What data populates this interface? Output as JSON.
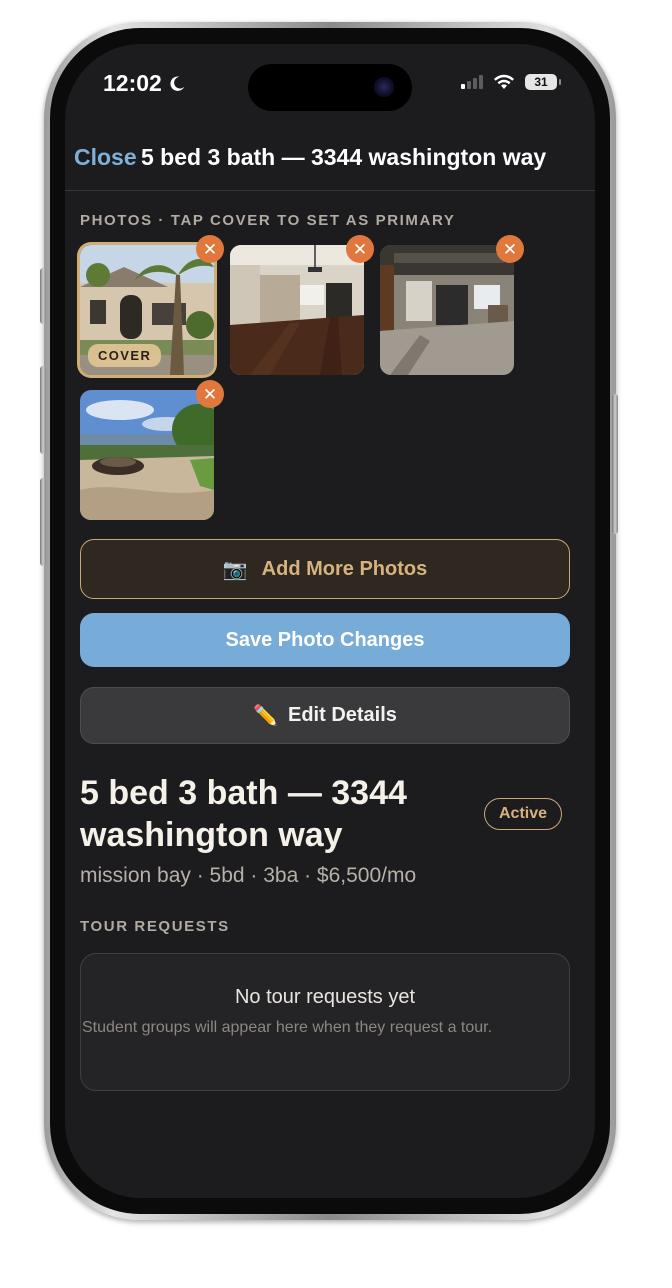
{
  "status_bar": {
    "time": "12:02",
    "battery": "31"
  },
  "header": {
    "close_label": "Close",
    "title": "5 bed 3 bath — 3344 washington way"
  },
  "photos": {
    "section_label": "Photos · Tap cover to set as primary",
    "cover_badge": "COVER",
    "remove_glyph": "✕",
    "items": [
      {
        "description_icon": "house-exterior-photo",
        "is_cover": true
      },
      {
        "description_icon": "living-room-photo",
        "is_cover": false
      },
      {
        "description_icon": "garage-photo",
        "is_cover": false
      },
      {
        "description_icon": "patio-photo",
        "is_cover": false
      }
    ]
  },
  "actions": {
    "add_photos_icon": "📷",
    "add_photos_label": "Add More Photos",
    "save_label": "Save Photo Changes",
    "edit_icon": "✏️",
    "edit_label": "Edit Details"
  },
  "listing": {
    "title": "5 bed 3 bath — 3344 washington way",
    "status": "Active",
    "subtitle": "mission bay · 5bd · 3ba · $6,500/mo"
  },
  "tour_requests": {
    "section_label": "Tour Requests",
    "empty_title": "No tour requests yet",
    "empty_description": "Student groups will appear here when they request a tour."
  },
  "colors": {
    "background": "#1c1c1e",
    "accent_gold": "#c9a97a",
    "accent_blue": "#78acd8",
    "remove_orange": "#e0783d"
  }
}
